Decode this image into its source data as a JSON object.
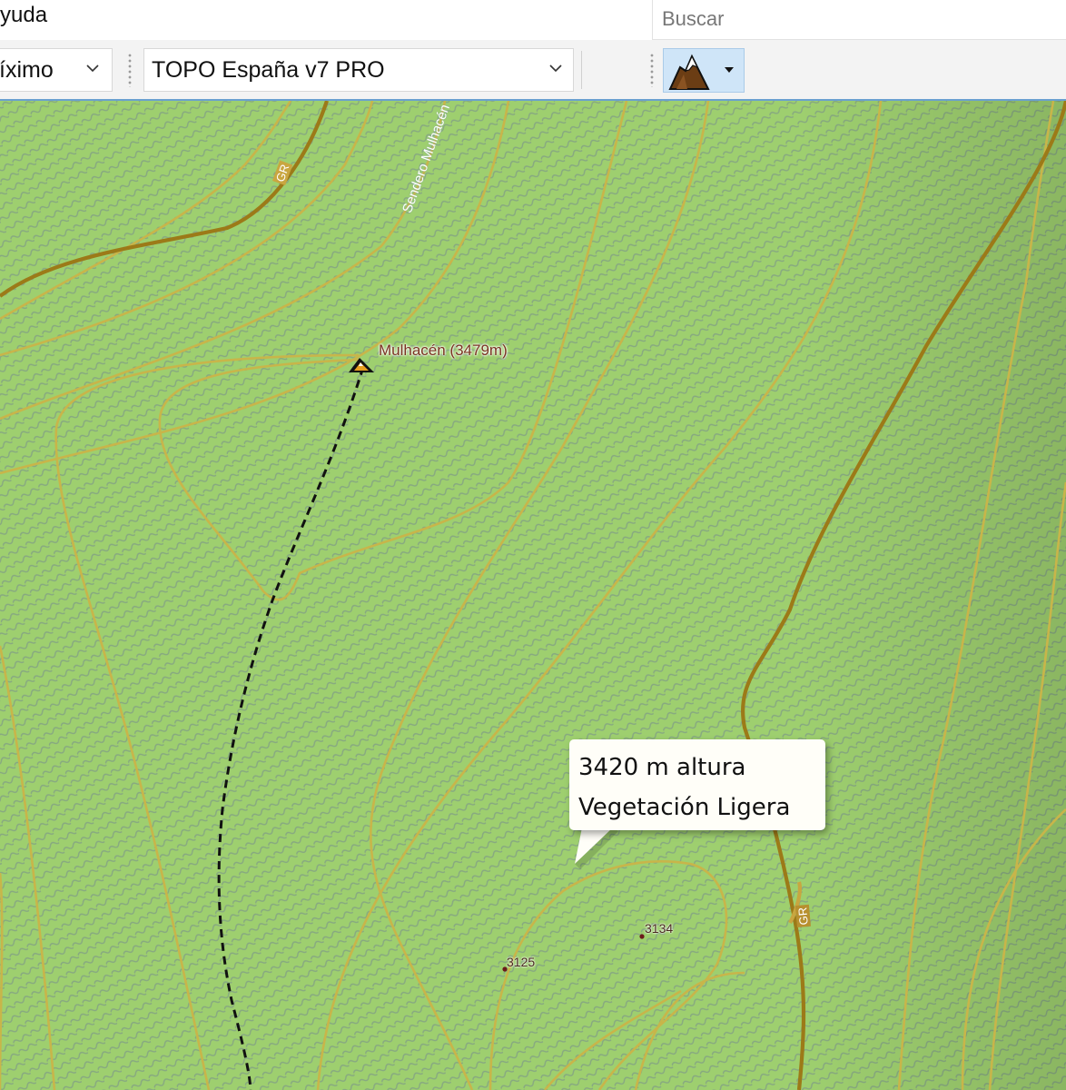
{
  "menubar": {
    "help_label": "yuda"
  },
  "search": {
    "placeholder": "Buscar"
  },
  "toolbar": {
    "zoom_value": "íximo",
    "map_value": "TOPO España v7 PRO",
    "relief_icon": "mountain-icon"
  },
  "map": {
    "peak_label": "Mulhacén (3479m)",
    "trail_label": "Sendero Mulhacén",
    "road_label_a": "GR",
    "road_label_b": "GR",
    "spot_heights": [
      "3134",
      "3125"
    ]
  },
  "tooltip": {
    "altitude": "3420 m altura",
    "terrain": "Vegetación Ligera"
  },
  "colors": {
    "terrain": "#9ecf6f",
    "hatch": "#7f9a86",
    "contour": "#c8b54a",
    "index_contour": "#9c7a18",
    "trail": "#111111",
    "accent": "#cfe5f8"
  }
}
